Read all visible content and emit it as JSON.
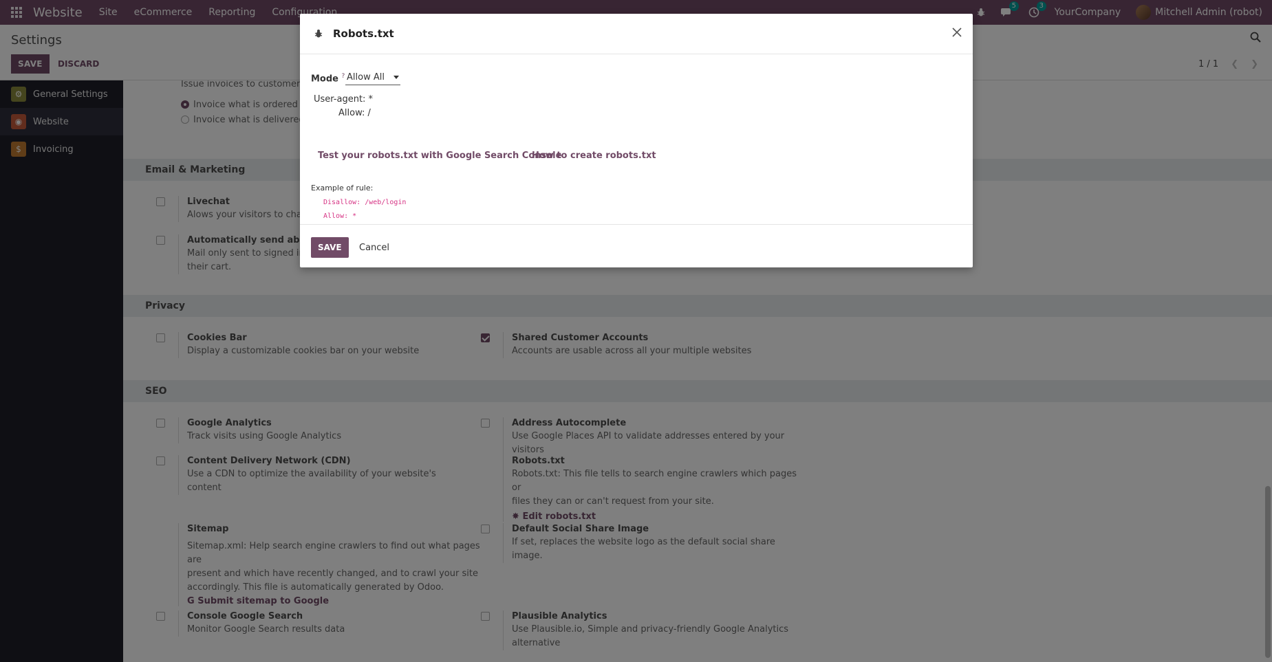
{
  "navbar": {
    "brand": "Website",
    "menu": [
      "Site",
      "eCommerce",
      "Reporting",
      "Configuration"
    ],
    "messages_count": "5",
    "activities_count": "3",
    "company": "YourCompany",
    "user": "Mitchell Admin (robot)"
  },
  "control": {
    "breadcrumb": "Settings",
    "save_label": "SAVE",
    "discard_label": "DISCARD",
    "pager": "1 / 1"
  },
  "sidebar": {
    "items": [
      {
        "label": "General Settings",
        "icon": "gear-icon",
        "color": "#a0a050"
      },
      {
        "label": "Website",
        "icon": "globe-icon",
        "color": "#d4663f"
      },
      {
        "label": "Invoicing",
        "icon": "invoice-icon",
        "color": "#d48d3f"
      }
    ]
  },
  "content": {
    "invoicing": {
      "desc": "Issue invoices to customers",
      "opt1": "Invoice what is ordered",
      "opt2": "Invoice what is delivered"
    },
    "sections": {
      "email_marketing": "Email & Marketing",
      "privacy": "Privacy",
      "seo": "SEO"
    },
    "livechat": {
      "title": "Livechat",
      "desc": "Alows your visitors to chat wi"
    },
    "abandoned": {
      "title": "Automatically send abandon",
      "desc1": "Mail only sent to signed in cu",
      "desc2": "their cart."
    },
    "cookies": {
      "title": "Cookies Bar",
      "desc": "Display a customizable cookies bar on your website"
    },
    "shared_accounts": {
      "title": "Shared Customer Accounts",
      "desc": "Accounts are usable across all your multiple websites"
    },
    "google_analytics": {
      "title": "Google Analytics",
      "desc": "Track visits using Google Analytics"
    },
    "address_autocomplete": {
      "title": "Address Autocomplete",
      "desc": "Use Google Places API to validate addresses entered by your visitors"
    },
    "cdn": {
      "title": "Content Delivery Network (CDN)",
      "desc": "Use a CDN to optimize the availability of your website's content"
    },
    "robots": {
      "title": "Robots.txt",
      "desc1": "Robots.txt: This file tells to search engine crawlers which pages or",
      "desc2": "files they can or can't request from your site.",
      "link": "Edit robots.txt"
    },
    "sitemap": {
      "title": "Sitemap",
      "desc1": "Sitemap.xml: Help search engine crawlers to find out what pages are",
      "desc2": "present and which have recently changed, and to crawl your site",
      "desc3": "accordingly. This file is automatically generated by Odoo.",
      "link": "Submit sitemap to Google"
    },
    "social_image": {
      "title": "Default Social Share Image",
      "desc": "If set, replaces the website logo as the default social share image."
    },
    "console_search": {
      "title": "Console Google Search",
      "desc": "Monitor Google Search results data"
    },
    "plausible": {
      "title": "Plausible Analytics",
      "desc1": "Use Plausible.io, Simple and privacy-friendly Google Analytics",
      "desc2": "alternative"
    }
  },
  "modal": {
    "title": "Robots.txt",
    "mode_label": "Mode",
    "mode_help": "?",
    "mode_value": "Allow All",
    "code_line1": "User-agent: *",
    "code_line2": "Allow: /",
    "link_test": "Test your robots.txt with Google Search Console",
    "link_howto": "How to create robots.txt",
    "example_label": "Example of rule:",
    "example_line1": "Disallow: /web/login",
    "example_line2": "Allow: *",
    "save_label": "SAVE",
    "cancel_label": "Cancel"
  }
}
